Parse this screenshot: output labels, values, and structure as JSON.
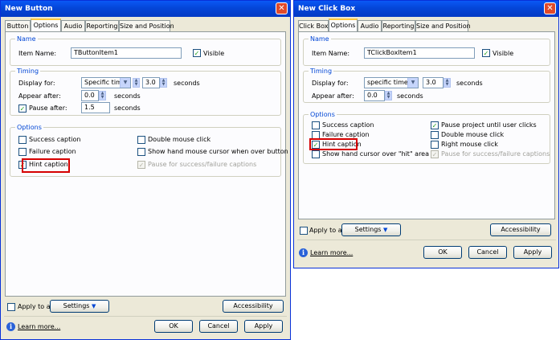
{
  "left": {
    "title": "New Button",
    "tabs": [
      "Button",
      "Options",
      "Audio",
      "Reporting",
      "Size and Position"
    ],
    "name_group": {
      "legend": "Name",
      "item_label": "Item Name:",
      "item_value": "TButtonItem1",
      "visible_label": "Visible"
    },
    "timing": {
      "legend": "Timing",
      "display_label": "Display for:",
      "display_value": "Specific time",
      "display_num": "3.0",
      "seconds": "seconds",
      "appear_label": "Appear after:",
      "appear_value": "0.0",
      "pause_label": "Pause after:",
      "pause_value": "1.5"
    },
    "options": {
      "legend": "Options",
      "success": "Success caption",
      "failure": "Failure caption",
      "hint": "Hint caption",
      "double": "Double mouse click",
      "hand": "Show hand mouse cursor when over button",
      "pause_sf": "Pause for success/failure captions"
    },
    "apply_to_all": "Apply to all",
    "settings": "Settings",
    "accessibility": "Accessibility",
    "learn_more": "Learn more...",
    "ok": "OK",
    "cancel": "Cancel",
    "apply": "Apply"
  },
  "right": {
    "title": "New Click Box",
    "tabs": [
      "Click Box",
      "Options",
      "Audio",
      "Reporting",
      "Size and Position"
    ],
    "name_group": {
      "legend": "Name",
      "item_label": "Item Name:",
      "item_value": "TClickBoxItem1",
      "visible_label": "Visible"
    },
    "timing": {
      "legend": "Timing",
      "display_label": "Display for:",
      "display_value": "specific time",
      "display_num": "3.0",
      "seconds": "seconds",
      "appear_label": "Appear after:",
      "appear_value": "0.0"
    },
    "options": {
      "legend": "Options",
      "success": "Success caption",
      "failure": "Failure caption",
      "hint": "Hint caption",
      "hand": "Show hand cursor over \"hit\" area",
      "pause_project": "Pause project until user clicks",
      "double": "Double mouse click",
      "right": "Right mouse click",
      "pause_sf": "Pause for success/failure captions"
    },
    "apply_to_all": "Apply to all",
    "settings": "Settings",
    "accessibility": "Accessibility",
    "learn_more": "Learn more...",
    "ok": "OK",
    "cancel": "Cancel",
    "apply": "Apply"
  },
  "colors": {
    "title": "#0446d8",
    "legend": "#0046d5",
    "highlight": "#d60000"
  },
  "icons": {
    "close": "close-icon",
    "info": "info-icon",
    "check": "checkmark-icon",
    "dropdown": "chevron-down-icon"
  }
}
